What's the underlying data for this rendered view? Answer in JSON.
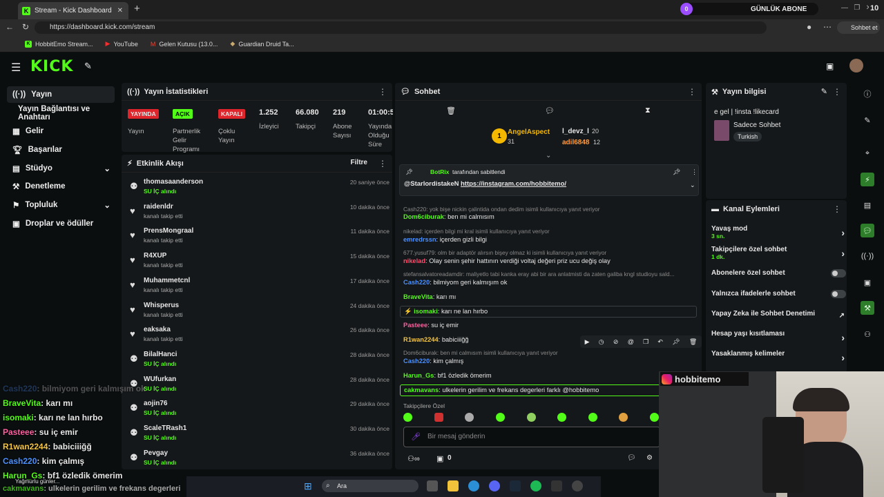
{
  "browser": {
    "tab_title": "Stream - Kick Dashboard",
    "url": "https://dashboard.kick.com/stream",
    "subscriber_widget": {
      "count": "0",
      "label": "GÜNLÜK ABONE",
      "right_count": "10"
    },
    "chat_button": "Sohbet et",
    "bookmarks": [
      "HobbitEmo Stream...",
      "YouTube",
      "Gelen Kutusu (13.0...",
      "Guardian Druid Ta..."
    ]
  },
  "sidebar": {
    "items": [
      {
        "label": "Yayın"
      },
      {
        "label": "Yayın Bağlantısı ve Anahtarı"
      },
      {
        "label": "Gelir"
      },
      {
        "label": "Başarılar"
      },
      {
        "label": "Stüdyo"
      },
      {
        "label": "Denetleme"
      },
      {
        "label": "Topluluk"
      },
      {
        "label": "Droplar ve ödüller"
      }
    ]
  },
  "stats": {
    "title": "Yayın İstatistikleri",
    "badges": [
      {
        "badge": "YAYINDA",
        "label": "Yayın",
        "color": "#e0242b"
      },
      {
        "badge": "AÇIK",
        "label": "Partnerlik Gelir Programı",
        "color": "#53fc18"
      },
      {
        "badge": "KAPALI",
        "label": "Çoklu Yayın",
        "color": "#e0242b"
      }
    ],
    "values": [
      {
        "value": "1.252",
        "label": "İzleyici"
      },
      {
        "value": "66.080",
        "label": "Takipçi"
      },
      {
        "value": "219",
        "label": "Abone Sayısı"
      },
      {
        "value": "01:00:5",
        "label": "Yayında Olduğu Süre"
      }
    ]
  },
  "activity": {
    "title": "Etkinlik Akışı",
    "filter": "Filtre",
    "rows": [
      {
        "name": "thomasaanderson",
        "sub": "SU İÇ alındı",
        "time": "20 saniye önce",
        "kind": "sub"
      },
      {
        "name": "raidenldr",
        "sub": "kanalı takip etti",
        "time": "10 dakika önce",
        "kind": "follow"
      },
      {
        "name": "PrensMongraal",
        "sub": "kanalı takip etti",
        "time": "11 dakika önce",
        "kind": "follow"
      },
      {
        "name": "R4XUP",
        "sub": "kanalı takip etti",
        "time": "15 dakika önce",
        "kind": "follow"
      },
      {
        "name": "Muhammetcnl",
        "sub": "kanalı takip etti",
        "time": "17 dakika önce",
        "kind": "follow"
      },
      {
        "name": "Whisperus",
        "sub": "kanalı takip etti",
        "time": "24 dakika önce",
        "kind": "follow"
      },
      {
        "name": "eaksaka",
        "sub": "kanalı takip etti",
        "time": "26 dakika önce",
        "kind": "follow"
      },
      {
        "name": "BilalHanci",
        "sub": "SU İÇ alındı",
        "time": "28 dakika önce",
        "kind": "sub"
      },
      {
        "name": "WUfurkan",
        "sub": "SU İÇ alındı",
        "time": "28 dakika önce",
        "kind": "sub"
      },
      {
        "name": "aojin76",
        "sub": "SU İÇ alındı",
        "time": "29 dakika önce",
        "kind": "sub"
      },
      {
        "name": "ScaleTRash1",
        "sub": "SU İÇ alındı",
        "time": "30 dakika önce",
        "kind": "sub"
      },
      {
        "name": "Pevgay",
        "sub": "SU İÇ alındı",
        "time": "36 dakika önce",
        "kind": "sub"
      }
    ]
  },
  "chat": {
    "title": "Sohbet",
    "leaders": {
      "first": "AngelAspect",
      "first_count": "31",
      "second": "l_devz_l",
      "second_count": "20",
      "third": "adil6848",
      "third_count": "12"
    },
    "pinned": {
      "by": "BotRix",
      "by_suffix": "tarafından sabitlendi",
      "mention": "@StarlordistakeN",
      "link": "https://instagram.com/hobbitemo/"
    },
    "messages": [
      {
        "reply": "Cash220: yok bişe nickin çalintida ondan dedim isimli kullanıcıya yanıt veriyor",
        "user": "Dom6ciburak",
        "color": "#53fc18",
        "text": "ben mi calmısım"
      },
      {
        "reply": "nikelad: içerden bilgi mi kral isimli kullanıcıya yanıt veriyor",
        "user": "emredrssn",
        "color": "#4a90ff",
        "text": "içerden gizli bilgi"
      },
      {
        "reply": "677.yusuf79: olm bir adaptör alırsın bişey olmaz ki isimli kullanıcıya yanıt veriyor",
        "user": "nikelad",
        "color": "#ff4d6d",
        "text": "Olay senin şehir hattının verdiği voltaj değeri priz ucu değiş olay"
      },
      {
        "reply": "stefansalvatoreadamdir: maliyetlo tabi kanka eray abi bir ara anlatmisti da zaten galiba kngl studioyu sald...",
        "user": "Cash220",
        "color": "#4a90ff",
        "text": "bilmiyom geri kalmışım ok"
      },
      {
        "reply": "",
        "user": "BraveVita",
        "color": "#53fc18",
        "text": "karı mı"
      },
      {
        "reply": "",
        "user": "isomaki",
        "color": "#53fc18",
        "text": "karı ne lan hırbo"
      },
      {
        "reply": "",
        "user": "Pasteee",
        "color": "#ff5ea0",
        "text": "su iç emir"
      },
      {
        "reply": "",
        "user": "R1wan2244",
        "color": "#f5c542",
        "text": "babiciiiğğ"
      },
      {
        "reply": "Dom6ciburak: ben mi calmısım isimli kullanıcıya yanıt veriyor",
        "user": "Cash220",
        "color": "#4a90ff",
        "text": "kim çalmış"
      },
      {
        "reply": "",
        "user": "Harun_Gs",
        "color": "#53fc18",
        "text": "bf1 özledik ömerim"
      },
      {
        "reply": "",
        "user": "cakmavans",
        "color": "#53fc18",
        "text": "ulkelerin gerilim ve frekans degerleri farklı @hobbitemo"
      }
    ],
    "emote_label": "Takipçilere Özel",
    "input_placeholder": "Bir mesaj gönderin",
    "footer_count": "0"
  },
  "stream_info": {
    "title_label": "Yayın bilgisi",
    "title": "e gel | !insta !likecard",
    "category": "Sadece Sohbet",
    "language": "Turkish"
  },
  "channel_actions": {
    "title": "Kanal Eylemleri",
    "rows": [
      {
        "label": "Yavaş mod",
        "sub": "3 sn.",
        "type": "arrow"
      },
      {
        "label": "Takipçilere özel sohbet",
        "sub": "1 dk.",
        "type": "arrow"
      },
      {
        "label": "Abonelere özel sohbet",
        "sub": "",
        "type": "toggle"
      },
      {
        "label": "Yalnızca ifadelerle sohbet",
        "sub": "",
        "type": "toggle"
      },
      {
        "label": "Yapay Zeka ile Sohbet Denetimi",
        "sub": "",
        "type": "external"
      },
      {
        "label": "Hesap yaşı kısıtlaması",
        "sub": "",
        "type": "arrow"
      },
      {
        "label": "Yasaklanmış kelimeler",
        "sub": "",
        "type": "arrow"
      }
    ]
  },
  "overlay": {
    "instagram": "hobbitemo",
    "chat": [
      {
        "user": "Cash220",
        "text": ": bilmiyom geri kalmışım ok",
        "color": "#4a90ff"
      },
      {
        "user": "BraveVita",
        "text": ": karı mı",
        "color": "#53fc18"
      },
      {
        "user": "isomaki",
        "text": ": karı ne lan hırbo",
        "color": "#53fc18"
      },
      {
        "user": "Pasteee",
        "text": ": su iç emir",
        "color": "#ff5ea0"
      },
      {
        "user": "R1wan2244",
        "text": ": babiciiiğğ",
        "color": "#f5c542"
      },
      {
        "user": "Cash220",
        "text": ": kim çalmış",
        "color": "#4a90ff"
      },
      {
        "user": "Harun_Gs",
        "text": ": bf1 özledik ömerim",
        "color": "#53fc18"
      },
      {
        "user": "cakmavans",
        "text": ": ulkelerin gerilim ve frekans degerleri",
        "color": "#53fc18"
      }
    ],
    "weather": "Yağmurlu günler..."
  },
  "taskbar": {
    "search": "Ara"
  },
  "colors": {
    "accent": "#53fc18",
    "live": "#e0242b"
  }
}
